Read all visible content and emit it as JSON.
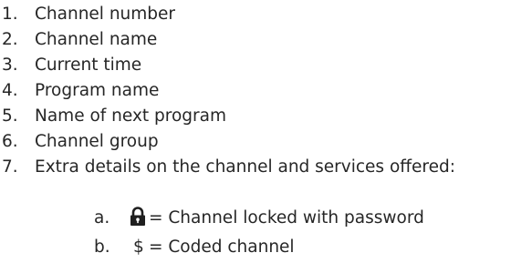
{
  "partial_heading": "...",
  "items": [
    {
      "number": "1.",
      "text": "Channel number"
    },
    {
      "number": "2.",
      "text": "Channel name"
    },
    {
      "number": "3.",
      "text": "Current time"
    },
    {
      "number": "4.",
      "text": "Program name"
    },
    {
      "number": "5.",
      "text": "Name of next program"
    },
    {
      "number": "6.",
      "text": "Channel group"
    },
    {
      "number": "7.",
      "text": "Extra details on the channel and services offered:"
    }
  ],
  "sub_items": [
    {
      "letter": "a.",
      "icon": "lock-icon",
      "text": "= Channel locked with password"
    },
    {
      "letter": "b.",
      "symbol": "$",
      "text": "= Coded channel"
    }
  ]
}
